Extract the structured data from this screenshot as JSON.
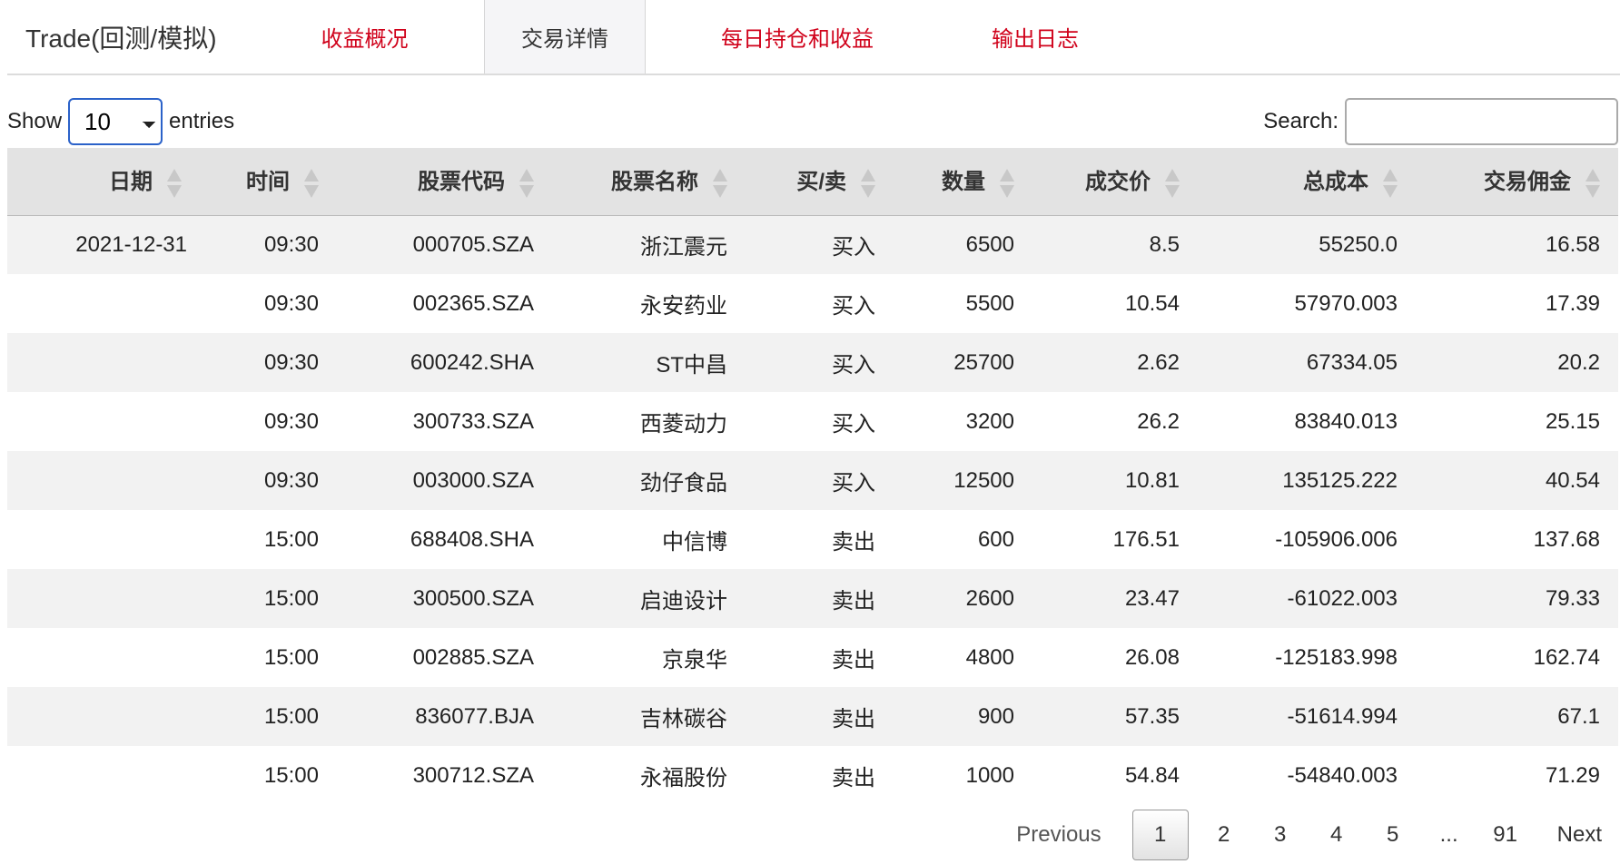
{
  "nav": {
    "brand": "Trade(回测/模拟)",
    "tabs": [
      {
        "label": "收益概况",
        "active": false
      },
      {
        "label": "交易详情",
        "active": true
      },
      {
        "label": "每日持仓和收益",
        "active": false
      },
      {
        "label": "输出日志",
        "active": false
      }
    ],
    "active_color": "#333333",
    "tab_color": "#d0021b"
  },
  "controls": {
    "show_label": "Show",
    "entries_value": "10",
    "entries_label": "entries",
    "search_label": "Search:",
    "search_value": ""
  },
  "table": {
    "columns": [
      "日期",
      "时间",
      "股票代码",
      "股票名称",
      "买/卖",
      "数量",
      "成交价",
      "总成本",
      "交易佣金"
    ],
    "rows": [
      [
        "2021-12-31",
        "09:30",
        "000705.SZA",
        "浙江震元",
        "买入",
        "6500",
        "8.5",
        "55250.0",
        "16.58"
      ],
      [
        "",
        "09:30",
        "002365.SZA",
        "永安药业",
        "买入",
        "5500",
        "10.54",
        "57970.003",
        "17.39"
      ],
      [
        "",
        "09:30",
        "600242.SHA",
        "ST中昌",
        "买入",
        "25700",
        "2.62",
        "67334.05",
        "20.2"
      ],
      [
        "",
        "09:30",
        "300733.SZA",
        "西菱动力",
        "买入",
        "3200",
        "26.2",
        "83840.013",
        "25.15"
      ],
      [
        "",
        "09:30",
        "003000.SZA",
        "劲仔食品",
        "买入",
        "12500",
        "10.81",
        "135125.222",
        "40.54"
      ],
      [
        "",
        "15:00",
        "688408.SHA",
        "中信博",
        "卖出",
        "600",
        "176.51",
        "-105906.006",
        "137.68"
      ],
      [
        "",
        "15:00",
        "300500.SZA",
        "启迪设计",
        "卖出",
        "2600",
        "23.47",
        "-61022.003",
        "79.33"
      ],
      [
        "",
        "15:00",
        "002885.SZA",
        "京泉华",
        "卖出",
        "4800",
        "26.08",
        "-125183.998",
        "162.74"
      ],
      [
        "",
        "15:00",
        "836077.BJA",
        "吉林碳谷",
        "卖出",
        "900",
        "57.35",
        "-51614.994",
        "67.1"
      ],
      [
        "",
        "15:00",
        "300712.SZA",
        "永福股份",
        "卖出",
        "1000",
        "54.84",
        "-54840.003",
        "71.29"
      ]
    ]
  },
  "pagination": {
    "previous": "Previous",
    "pages": [
      "1",
      "2",
      "3",
      "4",
      "5"
    ],
    "ellipsis": "...",
    "last": "91",
    "next": "Next",
    "current": "1"
  }
}
